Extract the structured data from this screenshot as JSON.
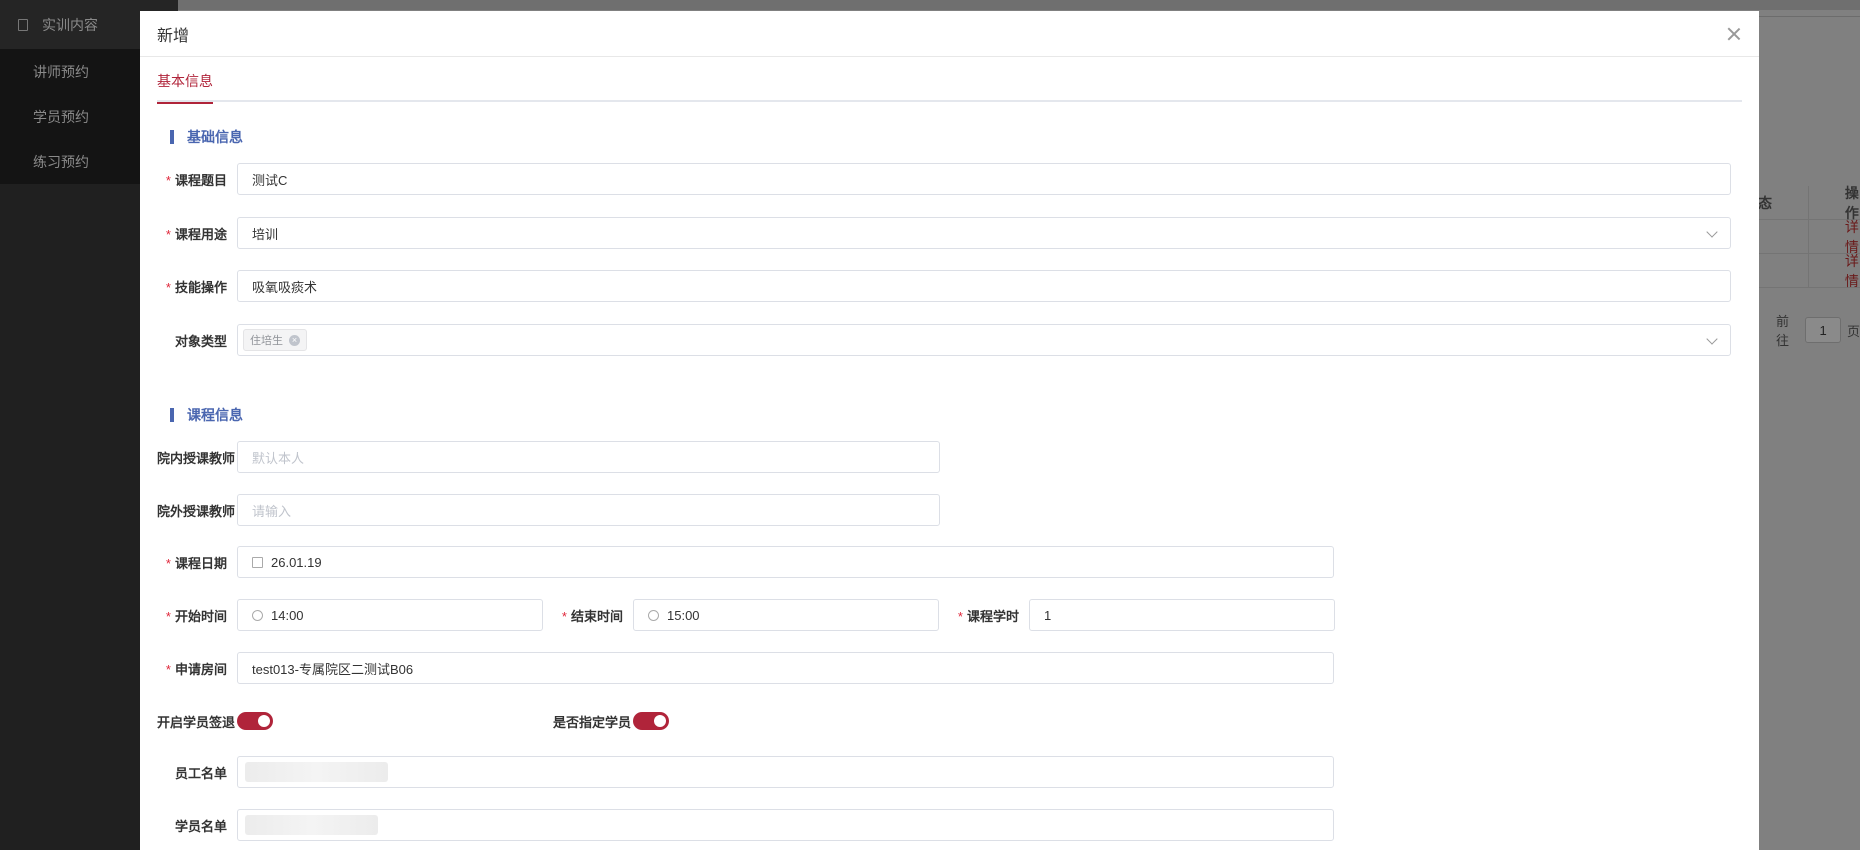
{
  "sidebar": {
    "group_label": "实训内容",
    "items": [
      {
        "label": "讲师预约"
      },
      {
        "label": "学员预约"
      },
      {
        "label": "练习预约"
      }
    ]
  },
  "background": {
    "table_header": {
      "col_a": "态",
      "col_b": "操作"
    },
    "rows": [
      {
        "action": "详情"
      },
      {
        "action": "详情"
      }
    ],
    "pager": {
      "goto_label": "前往",
      "page": "1",
      "page_suffix": "页"
    }
  },
  "modal": {
    "title": "新增",
    "tabs": [
      {
        "label": "基本信息",
        "active": true
      }
    ],
    "section_basic": "基础信息",
    "section_course": "课程信息",
    "fields": {
      "topic": {
        "label": "课程题目",
        "required": true,
        "value": "测试C"
      },
      "purpose": {
        "label": "课程用途",
        "required": true,
        "value": "培训"
      },
      "skill": {
        "label": "技能操作",
        "required": true,
        "value": "吸氧吸痰术"
      },
      "target": {
        "label": "对象类型",
        "required": false,
        "tags": [
          "住培生"
        ]
      },
      "inner_teacher": {
        "label": "院内授课教师",
        "placeholder": "默认本人"
      },
      "outer_teacher": {
        "label": "院外授课教师",
        "placeholder": "请输入"
      },
      "date": {
        "label": "课程日期",
        "required": true,
        "value": "26.01.19"
      },
      "start_time": {
        "label": "开始时间",
        "required": true,
        "value": "14:00"
      },
      "end_time": {
        "label": "结束时间",
        "required": true,
        "value": "15:00"
      },
      "hours": {
        "label": "课程学时",
        "required": true,
        "value": "1"
      },
      "room": {
        "label": "申请房间",
        "required": true,
        "value": "test013-专属院区二测试B06"
      },
      "signout": {
        "label": "开启学员签退",
        "on": true
      },
      "assign": {
        "label": "是否指定学员",
        "on": true
      },
      "staff_list": {
        "label": "员工名单"
      },
      "student_list": {
        "label": "学员名单"
      }
    }
  },
  "colors": {
    "accent": "#b0243a",
    "section": "#4a66b0",
    "required": "#e0263a"
  },
  "icons": [
    "close-icon",
    "chevron-down-icon",
    "calendar-icon",
    "clock-icon",
    "tag-close-icon",
    "menu-icon"
  ]
}
